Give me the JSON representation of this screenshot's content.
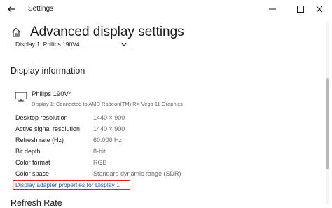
{
  "window": {
    "title": "Settings"
  },
  "page": {
    "title": "Advanced display settings"
  },
  "display_select": {
    "value": "Display 1: Philips 190V4"
  },
  "display_information": {
    "heading": "Display information",
    "monitor_name": "Philips 190V4",
    "monitor_description": "Display 1: Connected to AMD Radeon(TM) RX Vega 11 Graphics",
    "rows": [
      {
        "label": "Desktop resolution",
        "value": "1440 × 900"
      },
      {
        "label": "Active signal resolution",
        "value": "1440 × 900"
      },
      {
        "label": "Refresh rate (Hz)",
        "value": "60.000 Hz"
      },
      {
        "label": "Bit depth",
        "value": "8-bit"
      },
      {
        "label": "Color format",
        "value": "RGB"
      },
      {
        "label": "Color space",
        "value": "Standard dynamic range (SDR)"
      }
    ],
    "adapter_link": "Display adapter properties for Display 1"
  },
  "refresh_rate": {
    "heading": "Refresh Rate"
  },
  "colors": {
    "link": "#2458a6",
    "highlight_box": "#e02020"
  }
}
